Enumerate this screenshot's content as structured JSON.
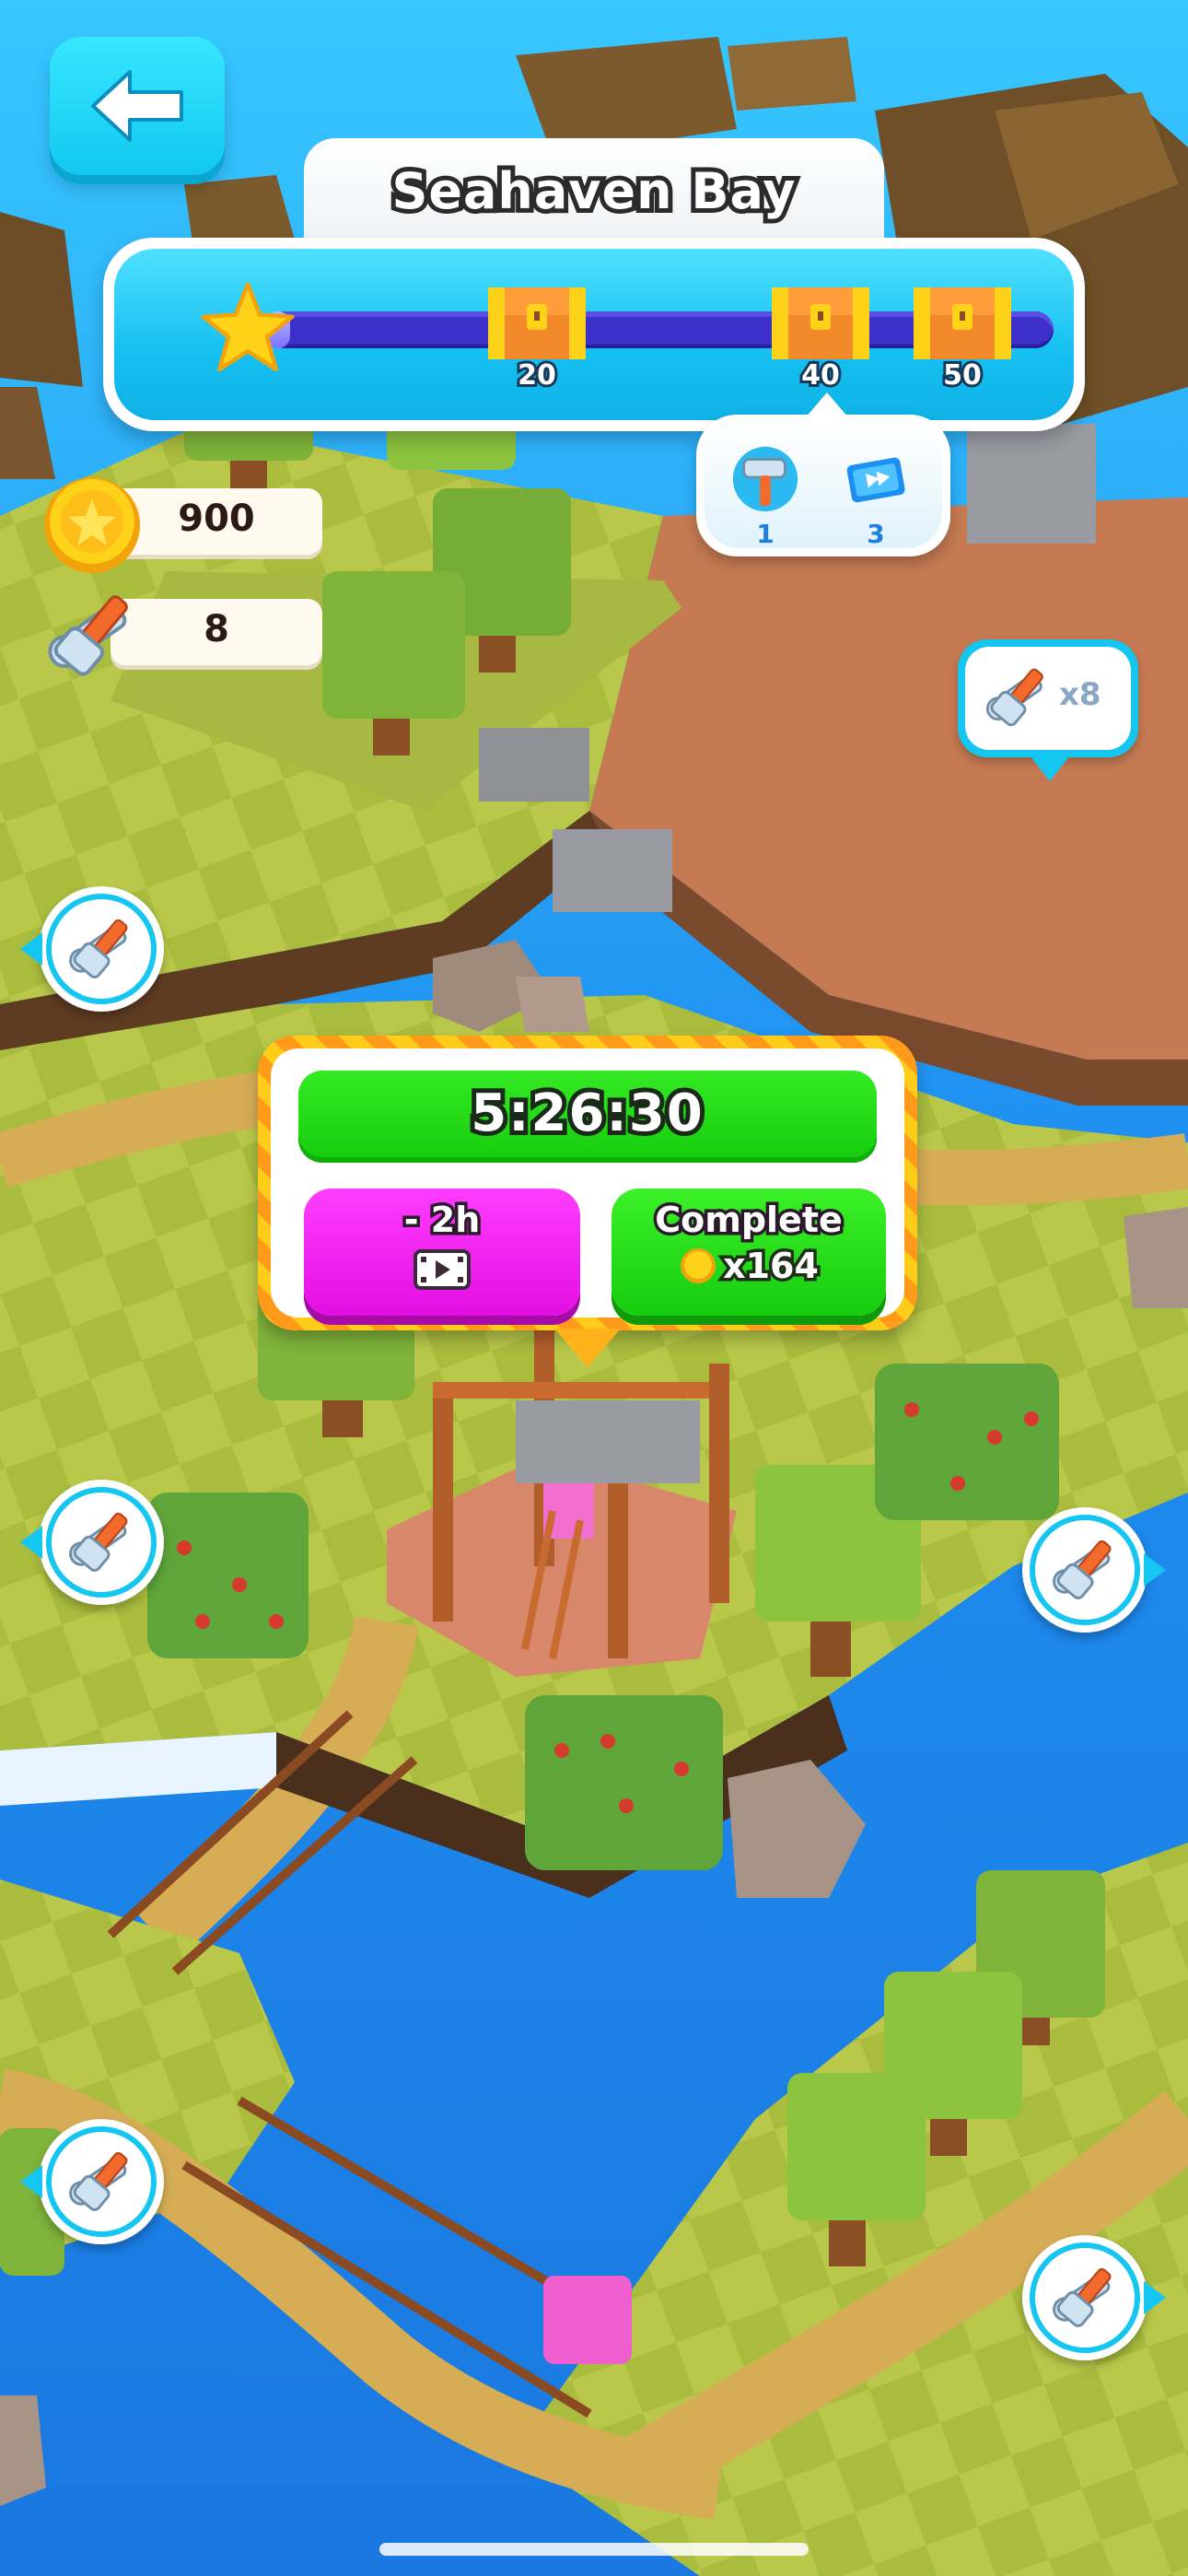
{
  "header": {
    "back_icon": "arrow-left-icon",
    "title": "Seahaven Bay"
  },
  "progress": {
    "fill_fraction": 0.03,
    "start_icon": "star-icon",
    "milestones": [
      {
        "label": "20",
        "icon": "treasure-chest-icon"
      },
      {
        "label": "40",
        "icon": "treasure-chest-icon"
      },
      {
        "label": "50",
        "icon": "treasure-chest-icon"
      }
    ]
  },
  "milestone_rewards": [
    {
      "icon": "hammer-icon",
      "count": "1"
    },
    {
      "icon": "skip-ticket-icon",
      "count": "3"
    }
  ],
  "currencies": {
    "coins": {
      "icon": "coin-icon",
      "value": "900"
    },
    "tools": {
      "icon": "tools-icon",
      "value": "8"
    }
  },
  "tool_bubble": {
    "icon": "tools-icon",
    "label": "x8"
  },
  "construction": {
    "timer": "5:26:30",
    "speedup_label": "- 2h",
    "speedup_icon": "video-icon",
    "complete_label": "Complete",
    "complete_cost": "x164",
    "cost_icon": "coin-icon"
  },
  "map_pins": [
    {
      "icon": "tools-icon"
    },
    {
      "icon": "tools-icon"
    },
    {
      "icon": "tools-icon"
    },
    {
      "icon": "tools-icon"
    },
    {
      "icon": "tools-icon"
    }
  ],
  "colors": {
    "water": "#1c86e8",
    "accent_cyan": "#14c6f0",
    "timer_green": "#15cc0d",
    "speedup_magenta": "#e20fe2",
    "popup_stripe": "#ffcc1a"
  }
}
